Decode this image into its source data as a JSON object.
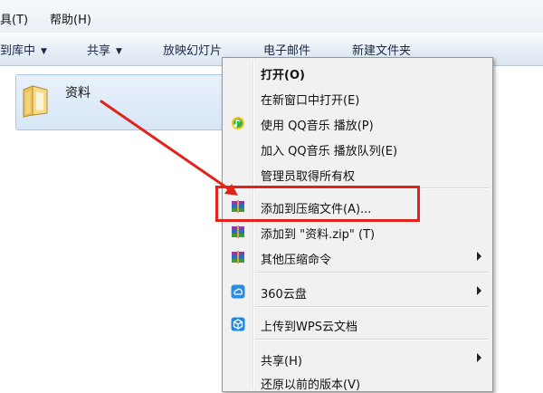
{
  "menubar": {
    "items": [
      {
        "label": "具(T)"
      },
      {
        "label": "帮助(H)"
      }
    ]
  },
  "toolbar": {
    "items": [
      {
        "label": "到库中",
        "has_dropdown": true
      },
      {
        "label": "共享",
        "has_dropdown": true
      },
      {
        "label": "放映幻灯片",
        "has_dropdown": false
      },
      {
        "label": "电子邮件",
        "has_dropdown": false
      },
      {
        "label": "新建文件夹",
        "has_dropdown": false
      }
    ],
    "dropdown_glyph": "▼"
  },
  "file": {
    "name": "资料",
    "icon": "folder-icon",
    "selected": true
  },
  "context_menu": {
    "items": [
      {
        "label": "打开(O)",
        "bold": true,
        "icon": null,
        "submenu": false
      },
      {
        "label": "在新窗口中打开(E)",
        "icon": null,
        "submenu": false
      },
      {
        "label": "使用 QQ音乐 播放(P)",
        "icon": "qq-music-icon",
        "submenu": false
      },
      {
        "label": "加入 QQ音乐 播放队列(E)",
        "icon": null,
        "submenu": false
      },
      {
        "label": "管理员取得所有权",
        "icon": null,
        "submenu": false
      },
      {
        "label": "添加到压缩文件(A)...",
        "icon": "winrar-icon",
        "submenu": false,
        "highlighted": true
      },
      {
        "label": "添加到 \"资料.zip\" (T)",
        "icon": "winrar-icon",
        "submenu": false
      },
      {
        "label": "其他压缩命令",
        "icon": "winrar-icon",
        "submenu": true
      },
      {
        "label": "360云盘",
        "icon": "cloud-360-icon",
        "submenu": true
      },
      {
        "label": "上传到WPS云文档",
        "icon": "wps-cloud-icon",
        "submenu": false
      },
      {
        "label": "共享(H)",
        "icon": null,
        "submenu": true
      },
      {
        "label": "还原以前的版本(V)",
        "icon": null,
        "submenu": false
      }
    ]
  },
  "colors": {
    "highlight_box": "#e2231a",
    "annotation_arrow": "#e2231a"
  }
}
